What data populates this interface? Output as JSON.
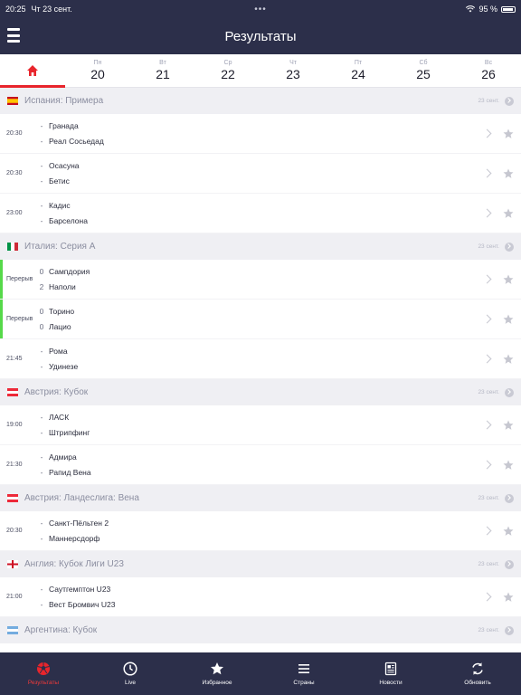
{
  "status": {
    "time": "20:25",
    "date": "Чт 23 сент.",
    "dots": "•••",
    "battery": "95 %"
  },
  "header": {
    "title": "Результаты"
  },
  "days": [
    {
      "name": "Пн",
      "num": "20"
    },
    {
      "name": "Вт",
      "num": "21"
    },
    {
      "name": "Ср",
      "num": "22"
    },
    {
      "name": "Чт",
      "num": "23"
    },
    {
      "name": "Пт",
      "num": "24"
    },
    {
      "name": "Сб",
      "num": "25"
    },
    {
      "name": "Вс",
      "num": "26"
    }
  ],
  "leagues": [
    {
      "name": "Испания: Примера",
      "date": "23 сент.",
      "flag": "es",
      "matches": [
        {
          "time": "20:30",
          "home": "Гранада",
          "away": "Реал Сосьедад",
          "hs": "-",
          "as": "-",
          "live": false
        },
        {
          "time": "20:30",
          "home": "Осасуна",
          "away": "Бетис",
          "hs": "-",
          "as": "-",
          "live": false
        },
        {
          "time": "23:00",
          "home": "Кадис",
          "away": "Барселона",
          "hs": "-",
          "as": "-",
          "live": false
        }
      ]
    },
    {
      "name": "Италия: Серия А",
      "date": "23 сент.",
      "flag": "it",
      "matches": [
        {
          "time": "Перерыв",
          "home": "Сампдория",
          "away": "Наполи",
          "hs": "0",
          "as": "2",
          "live": true
        },
        {
          "time": "Перерыв",
          "home": "Торино",
          "away": "Лацио",
          "hs": "0",
          "as": "0",
          "live": true
        },
        {
          "time": "21:45",
          "home": "Рома",
          "away": "Удинезе",
          "hs": "-",
          "as": "-",
          "live": false
        }
      ]
    },
    {
      "name": "Австрия: Кубок",
      "date": "23 сент.",
      "flag": "at",
      "matches": [
        {
          "time": "19:00",
          "home": "ЛАСК",
          "away": "Штрипфинг",
          "hs": "-",
          "as": "-",
          "live": false
        },
        {
          "time": "21:30",
          "home": "Адмира",
          "away": "Рапид Вена",
          "hs": "-",
          "as": "-",
          "live": false
        }
      ]
    },
    {
      "name": "Австрия: Ландеслига: Вена",
      "date": "23 сент.",
      "flag": "at",
      "matches": [
        {
          "time": "20:30",
          "home": "Санкт-Пёльтен 2",
          "away": "Маннерсдорф",
          "hs": "-",
          "as": "-",
          "live": false
        }
      ]
    },
    {
      "name": "Англия: Кубок Лиги U23",
      "date": "23 сент.",
      "flag": "en",
      "matches": [
        {
          "time": "21:00",
          "home": "Саутгемптон U23",
          "away": "Вест Бромвич U23",
          "hs": "-",
          "as": "-",
          "live": false
        }
      ]
    },
    {
      "name": "Аргентина: Кубок",
      "date": "23 сент.",
      "flag": "ar",
      "matches": []
    }
  ],
  "tabs": [
    {
      "label": "Результаты",
      "icon": "ball-icon"
    },
    {
      "label": "Live",
      "icon": "clock-icon"
    },
    {
      "label": "Избранное",
      "icon": "star-icon"
    },
    {
      "label": "Страны",
      "icon": "list-icon"
    },
    {
      "label": "Новости",
      "icon": "newspaper-icon"
    },
    {
      "label": "Обновить",
      "icon": "refresh-icon"
    }
  ],
  "colors": {
    "navy": "#2c2f4a",
    "accent": "#e8252c",
    "live": "#56d94a"
  }
}
